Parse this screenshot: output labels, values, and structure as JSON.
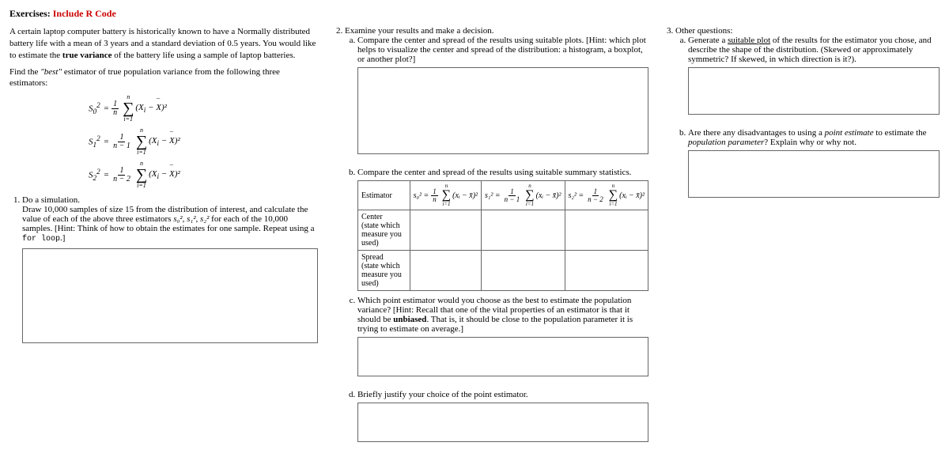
{
  "title_prefix": "Exercises:",
  "title_suffix": "Include R Code",
  "intro_p1": "A certain laptop computer battery is historically known to have a Normally distributed battery life with a mean of 3 years and a standard deviation of 0.5 years. You would like to estimate the ",
  "intro_bold": "true variance",
  "intro_p1_after": " of the battery life using a sample of laptop batteries.",
  "intro_p2_before": "Find the ",
  "intro_em": "\"best\"",
  "intro_p2_after": " estimator of true population variance from the following three estimators:",
  "formula": {
    "s0_lhs": "S",
    "s0_sub": "0",
    "s1_lhs": "S",
    "s1_sub": "1",
    "s2_lhs": "S",
    "s2_sub": "2",
    "sup2": "2",
    "eq": " = ",
    "num1": "1",
    "den_n": "n",
    "den_n1": "n − 1",
    "den_n2": "n − 2",
    "sum_top": "n",
    "sum_bot": "i=1",
    "term_open": "(X",
    "term_sub": "i",
    "term_minus": " − ",
    "term_xbar": "X",
    "term_close": ")²"
  },
  "q1_label": "Do a simulation.",
  "q1_desc_a": "Draw 10,000 samples of size 15 from the distribution of interest, and calculate the value of each of the above three estimators ",
  "q1_desc_s0": "s₀²",
  "q1_desc_s1": "s₁²",
  "q1_desc_s2": "s₂²",
  "q1_desc_b": " for each of the 10,000 samples. [Hint: Think of how to obtain the estimates for one sample. Repeat using a ",
  "q1_desc_mono": "for loop",
  "q1_desc_c": ".]",
  "q2_label": "Examine your results and make a decision.",
  "q2a": "Compare the center and spread of the results using suitable plots. [Hint: which plot helps to visualize the center and spread of the distribution: a histogram, a boxplot, or another plot?]",
  "q2b": "Compare the center and spread of the results using suitable summary statistics.",
  "table": {
    "h_estimator": "Estimator",
    "row_center": "Center\n(state which measure you used)",
    "row_spread": "Spread\n(state which measure you used)"
  },
  "est_formula": {
    "s0_lhs": "s₀² = ",
    "s1_lhs": "s₁² = ",
    "s2_lhs": "s₂² = ",
    "num1": "1",
    "den_n": "n",
    "den_n1": "n − 1",
    "den_n2": "n − 2",
    "sum_top": "n",
    "sum_bot": "i=1",
    "term": "(xᵢ − x̄)²"
  },
  "q2c_a": "Which point estimator would you choose as the best to estimate the population variance? [Hint: Recall that one of the vital properties of an estimator is that it should be ",
  "q2c_bold": "unbiased",
  "q2c_b": ". That is, it should be close to the population parameter it is trying to estimate on average.]",
  "q2d": "Briefly justify your choice of the point estimator.",
  "q3_label": "Other questions:",
  "q3a_a": "Generate a ",
  "q3a_u": "suitable plot",
  "q3a_b": " of the results for the estimator you chose, and describe the shape of the distribution. (Skewed or approximately symmetric? If skewed, in which direction is it?).",
  "q3b_a": "Are there any disadvantages to using a ",
  "q3b_em1": "point estimate",
  "q3b_b": " to estimate the ",
  "q3b_em2": "population parameter",
  "q3b_c": "? Explain why or why not."
}
